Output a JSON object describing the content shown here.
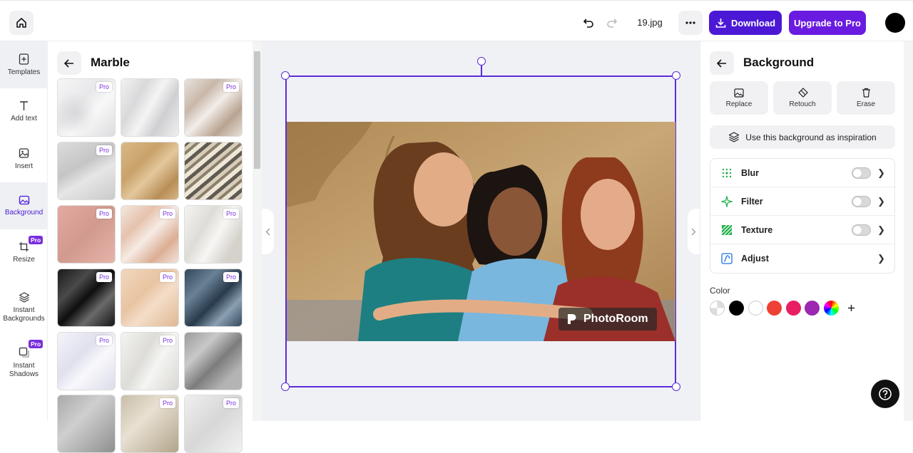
{
  "header": {
    "filename": "19.jpg",
    "download_label": "Download",
    "upgrade_label": "Upgrade to Pro"
  },
  "nav": {
    "items": [
      {
        "label": "Templates",
        "icon": "templates-icon"
      },
      {
        "label": "Add text",
        "icon": "text-icon"
      },
      {
        "label": "Insert",
        "icon": "insert-image-icon"
      },
      {
        "label": "Background",
        "icon": "background-icon"
      },
      {
        "label": "Resize",
        "icon": "crop-icon",
        "badge": "Pro"
      },
      {
        "label": "Instant Backgrounds",
        "icon": "layers-icon"
      },
      {
        "label": "Instant Shadows",
        "icon": "shadow-icon",
        "badge": "Pro"
      }
    ]
  },
  "library": {
    "title": "Marble",
    "pro_label": "Pro"
  },
  "canvas": {
    "watermark": "PhotoRoom"
  },
  "right_panel": {
    "title": "Background",
    "tools": [
      {
        "label": "Replace",
        "icon": "image-icon"
      },
      {
        "label": "Retouch",
        "icon": "eraser-icon"
      },
      {
        "label": "Erase",
        "icon": "trash-icon"
      }
    ],
    "inspiration_label": "Use this background as inspiration",
    "effects": [
      {
        "label": "Blur",
        "icon": "blur-icon",
        "toggle": false,
        "color": "#22b14c"
      },
      {
        "label": "Filter",
        "icon": "sparkle-icon",
        "toggle": false,
        "color": "#22b14c"
      },
      {
        "label": "Texture",
        "icon": "texture-icon",
        "toggle": false,
        "color": "#22b14c"
      },
      {
        "label": "Adjust",
        "icon": "adjust-icon",
        "color": "#1a73e8"
      }
    ],
    "color_label": "Color",
    "colors": [
      "transparent",
      "#000000",
      "#ffffff",
      "#ee4035",
      "#e91e63",
      "#9c27b0",
      "rainbow"
    ]
  },
  "accent": "#4b19d6"
}
